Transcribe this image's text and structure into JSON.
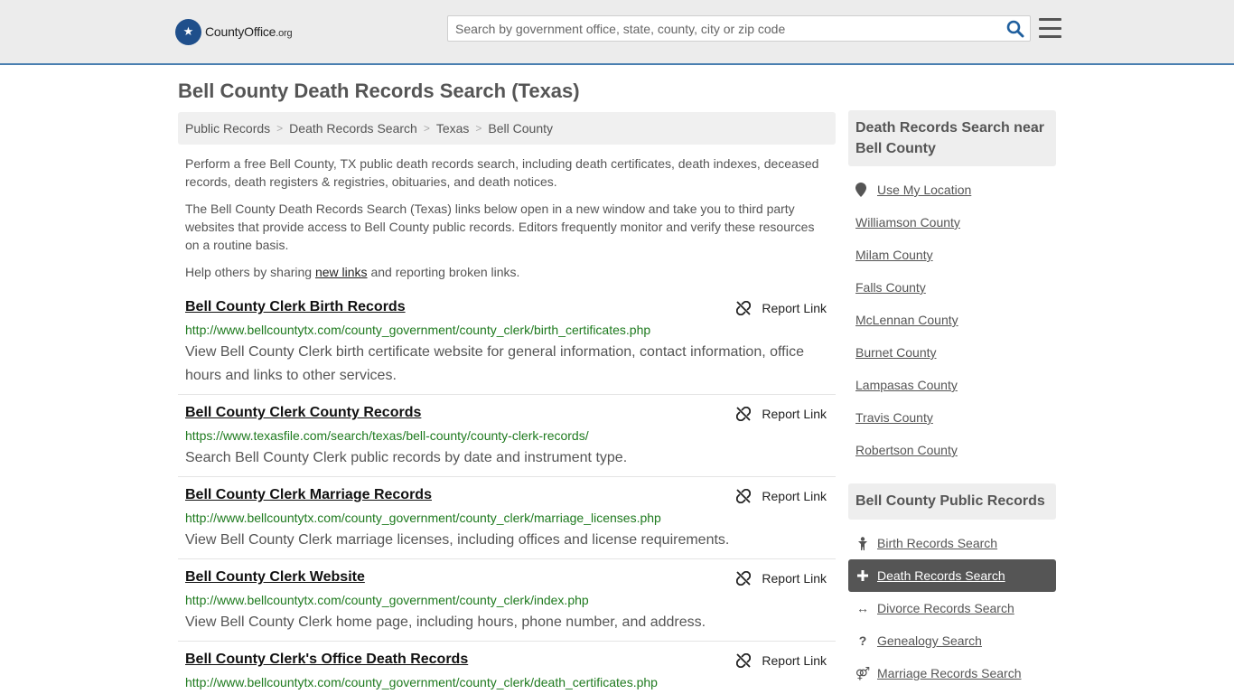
{
  "header": {
    "logo_main": "CountyOffice",
    "logo_suffix": ".org",
    "search_placeholder": "Search by government office, state, county, city or zip code"
  },
  "page_title": "Bell County Death Records Search (Texas)",
  "breadcrumb": [
    "Public Records",
    "Death Records Search",
    "Texas",
    "Bell County"
  ],
  "intro": {
    "p1": "Perform a free Bell County, TX public death records search, including death certificates, death indexes, deceased records, death registers & registries, obituaries, and death notices.",
    "p2": "The Bell County Death Records Search (Texas) links below open in a new window and take you to third party websites that provide access to Bell County public records. Editors frequently monitor and verify these resources on a routine basis.",
    "p3_before": "Help others by sharing ",
    "p3_link": "new links",
    "p3_after": " and reporting broken links."
  },
  "report_label": "Report Link",
  "results": [
    {
      "title": "Bell County Clerk Birth Records",
      "url": "http://www.bellcountytx.com/county_government/county_clerk/birth_certificates.php",
      "desc": "View Bell County Clerk birth certificate website for general information, contact information, office hours and links to other services."
    },
    {
      "title": "Bell County Clerk County Records",
      "url": "https://www.texasfile.com/search/texas/bell-county/county-clerk-records/",
      "desc": "Search Bell County Clerk public records by date and instrument type."
    },
    {
      "title": "Bell County Clerk Marriage Records",
      "url": "http://www.bellcountytx.com/county_government/county_clerk/marriage_licenses.php",
      "desc": "View Bell County Clerk marriage licenses, including offices and license requirements."
    },
    {
      "title": "Bell County Clerk Website",
      "url": "http://www.bellcountytx.com/county_government/county_clerk/index.php",
      "desc": "View Bell County Clerk home page, including hours, phone number, and address."
    },
    {
      "title": "Bell County Clerk's Office Death Records",
      "url": "http://www.bellcountytx.com/county_government/county_clerk/death_certificates.php",
      "desc": ""
    }
  ],
  "sidebar": {
    "nearby_title": "Death Records Search near Bell County",
    "use_location": "Use My Location",
    "nearby": [
      "Williamson County",
      "Milam County",
      "Falls County",
      "McLennan County",
      "Burnet County",
      "Lampasas County",
      "Travis County",
      "Robertson County"
    ],
    "public_title": "Bell County Public Records",
    "public_items": [
      {
        "label": "Birth Records Search",
        "icon": "child-icon",
        "active": false
      },
      {
        "label": "Death Records Search",
        "icon": "plus-icon",
        "active": true
      },
      {
        "label": "Divorce Records Search",
        "icon": "arrows-horizontal-icon",
        "active": false
      },
      {
        "label": "Genealogy Search",
        "icon": "question-icon",
        "active": false
      },
      {
        "label": "Marriage Records Search",
        "icon": "gender-icon",
        "active": false
      }
    ]
  },
  "colors": {
    "accent": "#4a7fb0",
    "url_green": "#1e7a1e",
    "active_bg": "#555555"
  }
}
